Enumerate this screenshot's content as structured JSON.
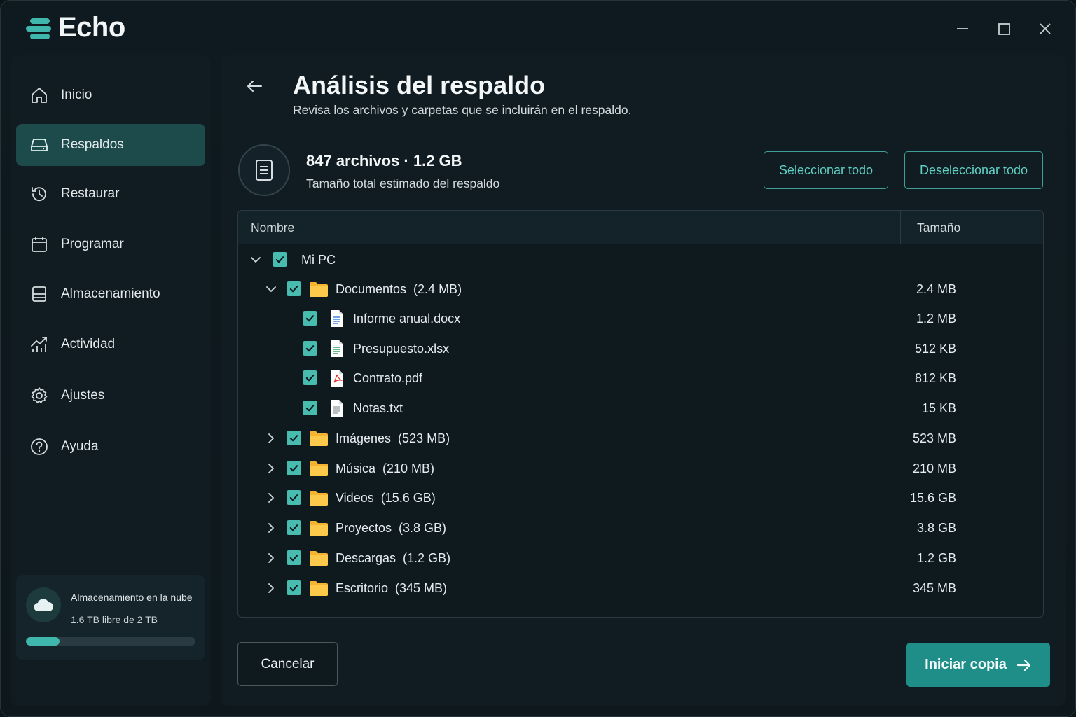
{
  "app": {
    "title": "Echo"
  },
  "colors": {
    "accent": "#3fb7ac",
    "accent_dark": "#1f8e88",
    "active_nav": "#1d4a4a",
    "background": "#0f1a20"
  },
  "window_controls": [
    {
      "name": "minimize-button",
      "icon": "minimize-icon"
    },
    {
      "name": "maximize-button",
      "icon": "maximize-icon"
    },
    {
      "name": "close-button",
      "icon": "close-icon"
    }
  ],
  "sidebar": {
    "items": [
      {
        "label": "Inicio",
        "icon": "home-icon",
        "active": false
      },
      {
        "label": "Respaldos",
        "icon": "drive-icon",
        "active": true
      },
      {
        "label": "Restaurar",
        "icon": "history-icon",
        "active": false
      },
      {
        "label": "Programar",
        "icon": "calendar-icon",
        "active": false
      },
      {
        "label": "Almacenamiento",
        "icon": "storage-icon",
        "active": false
      },
      {
        "label": "Actividad",
        "icon": "activity-icon",
        "active": false
      },
      {
        "label": "Ajustes",
        "icon": "gear-icon",
        "active": false
      },
      {
        "label": "Ayuda",
        "icon": "help-icon",
        "active": false
      }
    ],
    "cloud": {
      "title": "Almacenamiento en la nube",
      "subtitle": "1.6 TB libre de 2 TB",
      "used_fraction": 0.2,
      "icon": "cloud-icon"
    }
  },
  "main": {
    "title": "Análisis del respaldo",
    "subtitle": "Revisa los archivos y carpetas que se incluirán en el respaldo.",
    "summary": {
      "title": "847 archivos · 1.2 GB",
      "subtitle": "Tamaño total estimado del respaldo",
      "icon": "document-icon"
    },
    "select_all": "Seleccionar todo",
    "deselect_all": "Deseleccionar todo",
    "columns": {
      "name": "Nombre",
      "size": "Tamaño"
    },
    "tree": [
      {
        "name": "Mi PC",
        "size": "",
        "type": "root",
        "level": 0,
        "expanded": true,
        "checked": true
      },
      {
        "name": "Documentos  (2.4 MB)",
        "size": "2.4 MB",
        "type": "folder",
        "level": 1,
        "expanded": true,
        "checked": true
      },
      {
        "name": "Informe anual.docx",
        "size": "1.2 MB",
        "type": "docx",
        "level": 2,
        "checked": true
      },
      {
        "name": "Presupuesto.xlsx",
        "size": "512 KB",
        "type": "xlsx",
        "level": 2,
        "checked": true
      },
      {
        "name": "Contrato.pdf",
        "size": "812 KB",
        "type": "pdf",
        "level": 2,
        "checked": true
      },
      {
        "name": "Notas.txt",
        "size": "15 KB",
        "type": "txt",
        "level": 2,
        "checked": true
      },
      {
        "name": "Imágenes  (523 MB)",
        "size": "523 MB",
        "type": "folder",
        "level": 1,
        "expanded": false,
        "checked": true
      },
      {
        "name": "Música  (210 MB)",
        "size": "210 MB",
        "type": "folder",
        "level": 1,
        "expanded": false,
        "checked": true
      },
      {
        "name": "Videos  (15.6 GB)",
        "size": "15.6 GB",
        "type": "folder",
        "level": 1,
        "expanded": false,
        "checked": true
      },
      {
        "name": "Proyectos  (3.8 GB)",
        "size": "3.8 GB",
        "type": "folder",
        "level": 1,
        "expanded": false,
        "checked": true
      },
      {
        "name": "Descargas  (1.2 GB)",
        "size": "1.2 GB",
        "type": "folder",
        "level": 1,
        "expanded": false,
        "checked": true
      },
      {
        "name": "Escritorio  (345 MB)",
        "size": "345 MB",
        "type": "folder",
        "level": 1,
        "expanded": false,
        "checked": true
      }
    ],
    "cancel": "Cancelar",
    "start": "Iniciar copia"
  }
}
